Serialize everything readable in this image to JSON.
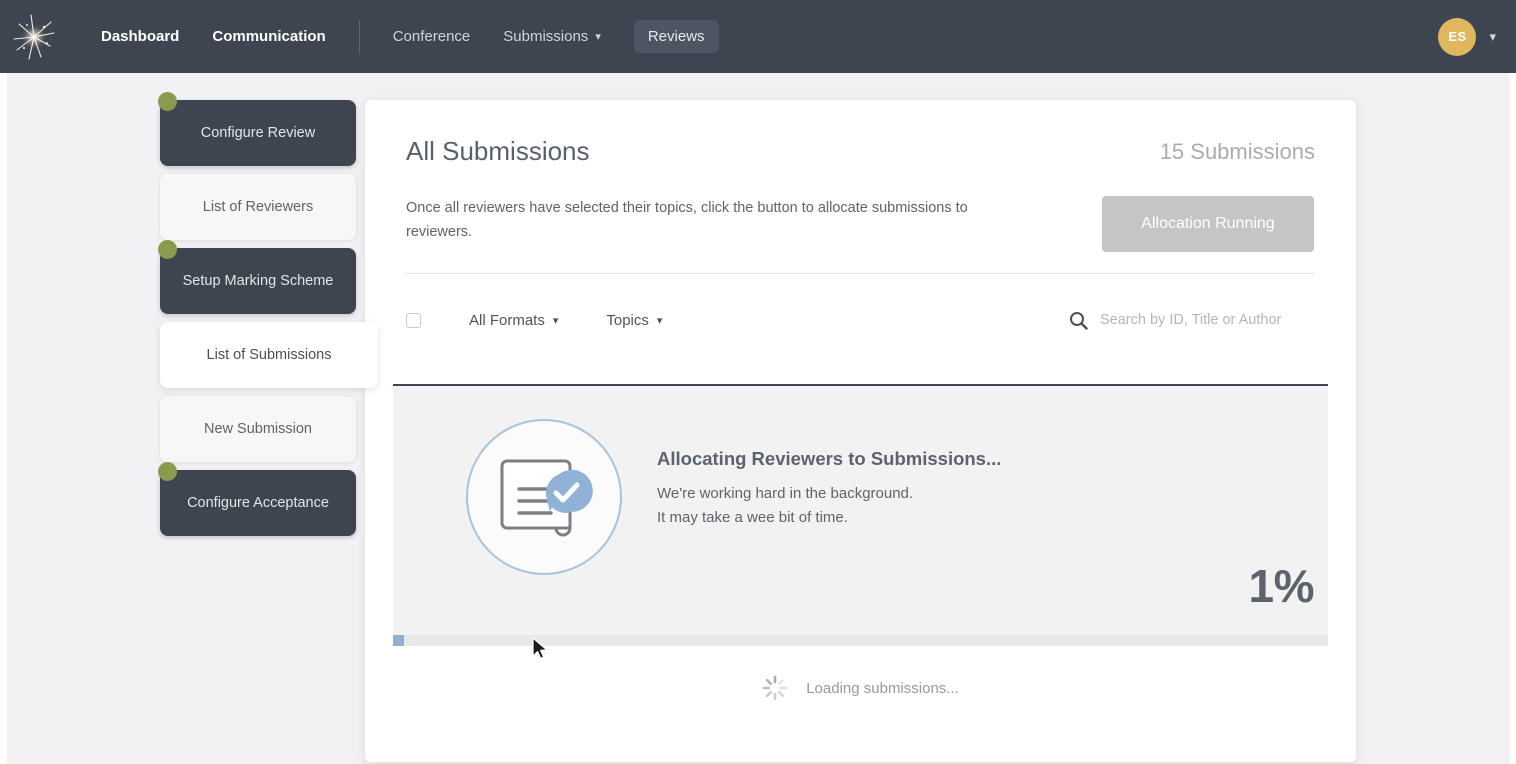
{
  "topnav": {
    "logo": "starburst-logo",
    "links": [
      {
        "label": "Dashboard",
        "style": "strong"
      },
      {
        "label": "Communication",
        "style": "strong"
      },
      {
        "label": "Conference",
        "style": "normal"
      },
      {
        "label": "Submissions",
        "style": "dropdown"
      },
      {
        "label": "Reviews",
        "style": "active"
      }
    ],
    "dropdown_caret": "▾",
    "avatar": {
      "initials": "ES",
      "caret": "▾"
    }
  },
  "sidebar": {
    "items": [
      {
        "label": "Configure Review",
        "state": "dark",
        "dot": true
      },
      {
        "label": "List of Reviewers",
        "state": "light",
        "dot": false
      },
      {
        "label": "Setup Marking Scheme",
        "state": "dark",
        "dot": true
      },
      {
        "label": "List of Submissions",
        "state": "active",
        "dot": false
      },
      {
        "label": "New Submission",
        "state": "light",
        "dot": false
      },
      {
        "label": "Configure Acceptance",
        "state": "dark",
        "dot": true
      }
    ]
  },
  "card": {
    "title": "All Submissions",
    "count_label": "15 Submissions",
    "description": "Once all reviewers have selected their topics, click the button to allocate submissions to reviewers.",
    "allocation_button": "Allocation Running"
  },
  "filters": {
    "formats_label": "All Formats",
    "topics_label": "Topics",
    "caret": "▾",
    "search_placeholder": "Search by ID, Title or Author",
    "search_value": "",
    "search_icon": "search-icon"
  },
  "loading_panel": {
    "icon": "document-check-icon",
    "title": "Allocating Reviewers to Submissions...",
    "line1": "We're working hard in the background.",
    "line2": "It may take a wee bit of time.",
    "percent_label": "1%",
    "progress_percent": 1
  },
  "footer_loading": {
    "spinner": "spinner-icon",
    "text": "Loading submissions..."
  },
  "colors": {
    "nav_bg": "#3d4550",
    "accent_green": "#8a9b4e",
    "avatar_gold": "#e0b65f",
    "progress_blue": "#8fb0d2",
    "disabled_gray": "#c4c5c7",
    "page_bg": "#f2f1f3"
  }
}
